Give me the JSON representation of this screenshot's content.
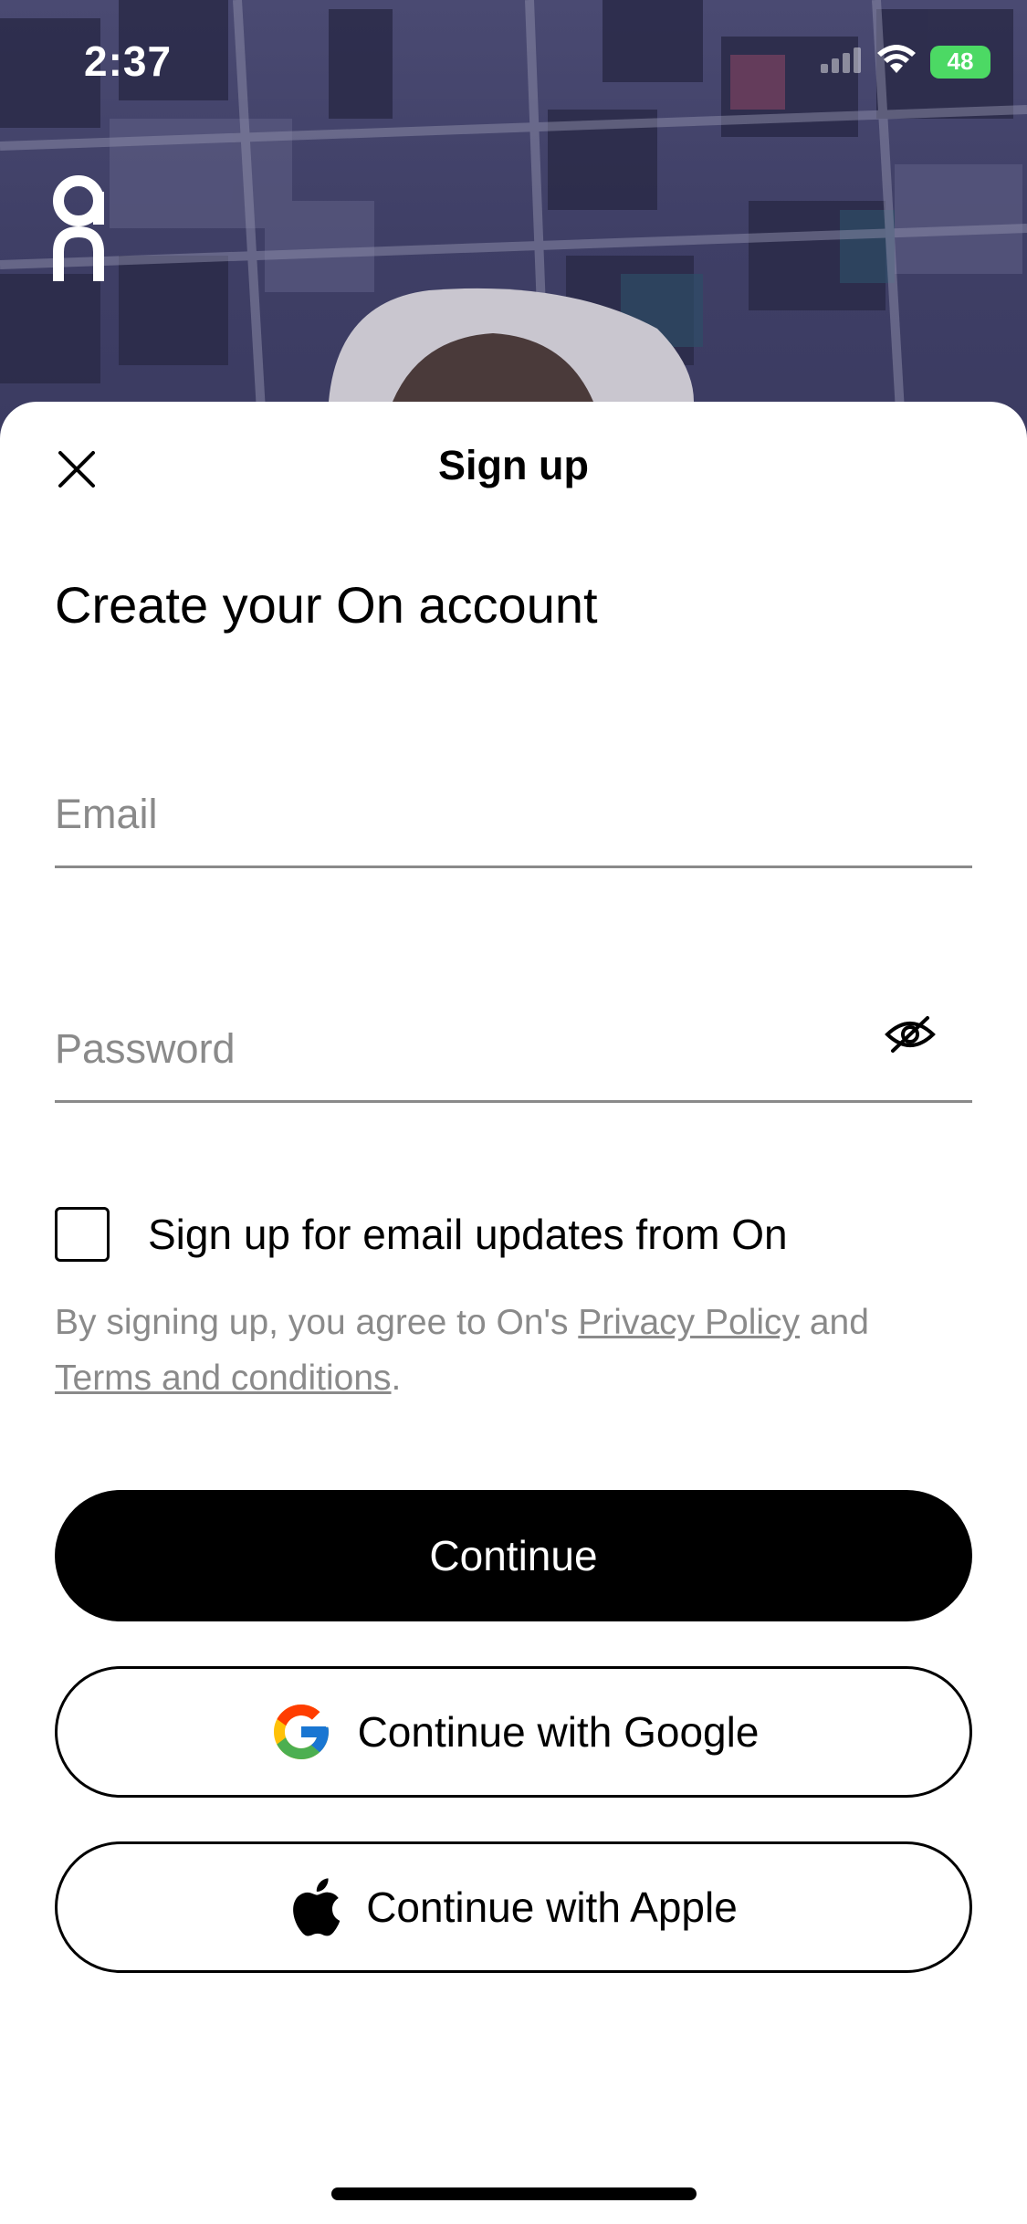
{
  "status_bar": {
    "time": "2:37",
    "battery": "48"
  },
  "header": {
    "title": "Sign up"
  },
  "main": {
    "heading": "Create your On account",
    "email_placeholder": "Email",
    "password_placeholder": "Password",
    "newsletter_label": "Sign up for email updates from On",
    "legal": {
      "prefix": "By signing up, you agree to On's ",
      "privacy_link": "Privacy Policy",
      "middle": " and",
      "terms_link": "Terms and conditions",
      "suffix": "."
    }
  },
  "buttons": {
    "continue": "Continue",
    "google": "Continue with Google",
    "apple": "Continue with Apple"
  },
  "icons": {
    "close": "close-icon",
    "password_toggle": "eye-off-icon",
    "google": "google-icon",
    "apple": "apple-icon",
    "logo": "on-logo"
  },
  "colors": {
    "primary": "#000000",
    "muted": "#8a8a8a",
    "battery": "#4cd964"
  }
}
